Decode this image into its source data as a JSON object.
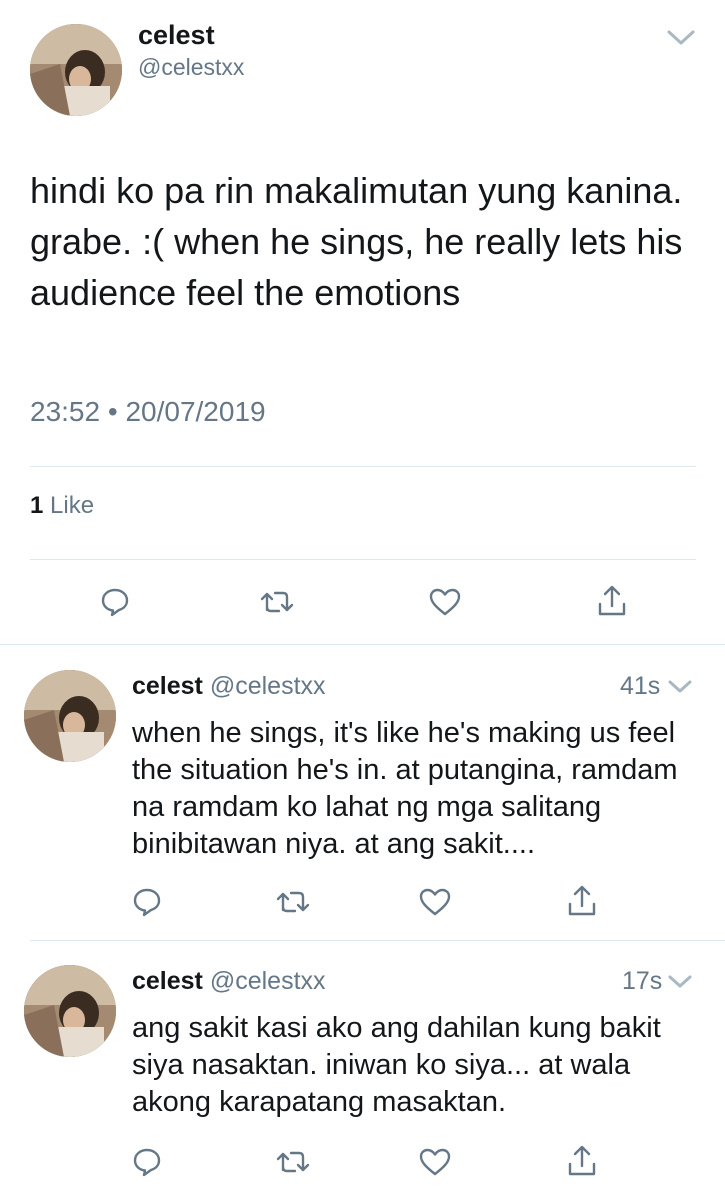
{
  "main_tweet": {
    "name": "celest",
    "handle": "@celestxx",
    "text": "hindi ko pa rin makalimutan yung kanina. grabe. :( when he sings, he really lets his audience feel the emotions",
    "time": "23:52",
    "separator": "•",
    "date": "20/07/2019",
    "like_count": "1",
    "like_label": "Like"
  },
  "replies": [
    {
      "name": "celest",
      "handle": "@celestxx",
      "age": "41s",
      "text": "when he sings, it's like he's making us feel the situation he's in. at putangina, ramdam na ramdam ko lahat ng mga salitang binibitawan niya. at ang sakit...."
    },
    {
      "name": "celest",
      "handle": "@celestxx",
      "age": "17s",
      "text": "ang sakit kasi ako ang dahilan kung bakit siya nasaktan. iniwan ko siya... at wala akong karapatang masaktan."
    }
  ],
  "icons": [
    "chevron-down-icon",
    "reply-icon",
    "retweet-icon",
    "like-icon",
    "share-icon"
  ],
  "colors": {
    "text": "#14171a",
    "secondary": "#657786",
    "divider": "#e1e8ed",
    "chevron": "#aab8c2"
  }
}
